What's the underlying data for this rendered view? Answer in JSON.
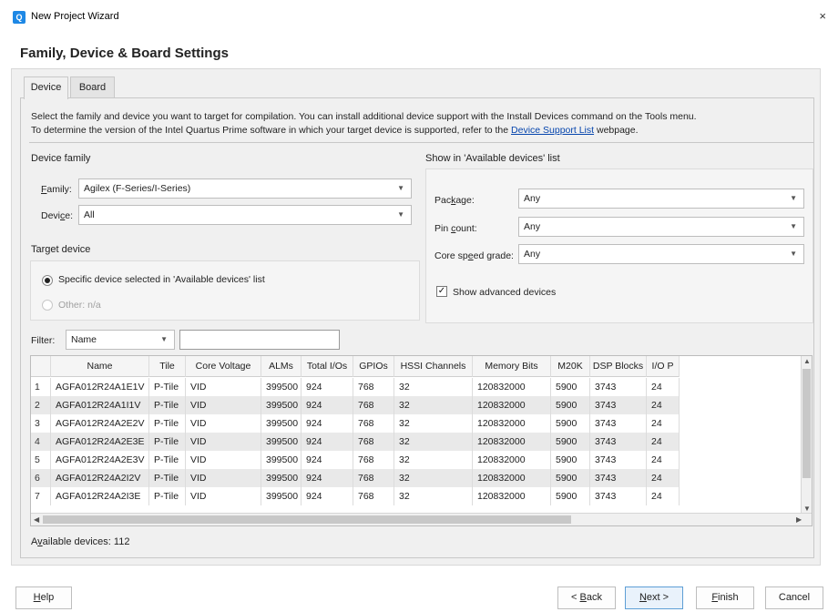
{
  "window": {
    "title": "New Project Wizard",
    "icon": "quartus-app-icon",
    "close_glyph": "×"
  },
  "page": {
    "heading": "Family, Device & Board Settings"
  },
  "tabs": [
    {
      "label": "Device",
      "active": true
    },
    {
      "label": "Board",
      "active": false
    }
  ],
  "description": {
    "line1": "Select the family and device you want to target for compilation. You can install additional device support with the Install Devices command on the Tools menu.",
    "line2_prefix": "To determine the version of the Intel Quartus Prime software in which your target device is supported, refer to the ",
    "line2_link": "Device Support List",
    "line2_suffix": " webpage."
  },
  "device_family": {
    "group_label": "Device family",
    "family_label": "Family:",
    "family_value": "Agilex (F-Series/I-Series)",
    "device_label": "Device:",
    "device_value": "All"
  },
  "target_device": {
    "group_label": "Target device",
    "specific_label": "Specific device selected in 'Available devices' list",
    "specific_selected": true,
    "other_label": "Other:",
    "other_value": "n/a"
  },
  "show_in_list": {
    "group_label": "Show in 'Available devices' list",
    "package_label": "Package:",
    "package_value": "Any",
    "pin_count_label": "Pin count:",
    "pin_count_value": "Any",
    "speed_label": "Core speed grade:",
    "speed_value": "Any",
    "advanced_label": "Show advanced devices",
    "advanced_checked": true,
    "check_glyph": "✓"
  },
  "filter": {
    "label": "Filter:",
    "field": "Name",
    "text": ""
  },
  "table": {
    "columns": [
      "",
      "Name",
      "Tile",
      "Core Voltage",
      "ALMs",
      "Total I/Os",
      "GPIOs",
      "HSSI Channels",
      "Memory Bits",
      "M20K",
      "DSP Blocks",
      "I/O P"
    ],
    "rows": [
      [
        "1",
        "AGFA012R24A1E1V",
        "P-Tile",
        "VID",
        "399500",
        "924",
        "768",
        "32",
        "120832000",
        "5900",
        "3743",
        "24"
      ],
      [
        "2",
        "AGFA012R24A1I1V",
        "P-Tile",
        "VID",
        "399500",
        "924",
        "768",
        "32",
        "120832000",
        "5900",
        "3743",
        "24"
      ],
      [
        "3",
        "AGFA012R24A2E2V",
        "P-Tile",
        "VID",
        "399500",
        "924",
        "768",
        "32",
        "120832000",
        "5900",
        "3743",
        "24"
      ],
      [
        "4",
        "AGFA012R24A2E3E",
        "P-Tile",
        "VID",
        "399500",
        "924",
        "768",
        "32",
        "120832000",
        "5900",
        "3743",
        "24"
      ],
      [
        "5",
        "AGFA012R24A2E3V",
        "P-Tile",
        "VID",
        "399500",
        "924",
        "768",
        "32",
        "120832000",
        "5900",
        "3743",
        "24"
      ],
      [
        "6",
        "AGFA012R24A2I2V",
        "P-Tile",
        "VID",
        "399500",
        "924",
        "768",
        "32",
        "120832000",
        "5900",
        "3743",
        "24"
      ],
      [
        "7",
        "AGFA012R24A2I3E",
        "P-Tile",
        "VID",
        "399500",
        "924",
        "768",
        "32",
        "120832000",
        "5900",
        "3743",
        "24"
      ]
    ]
  },
  "available": {
    "text": "Available devices: 112"
  },
  "buttons": {
    "help": "Help",
    "back": "< Back",
    "next": "Next >",
    "finish": "Finish",
    "cancel": "Cancel"
  }
}
